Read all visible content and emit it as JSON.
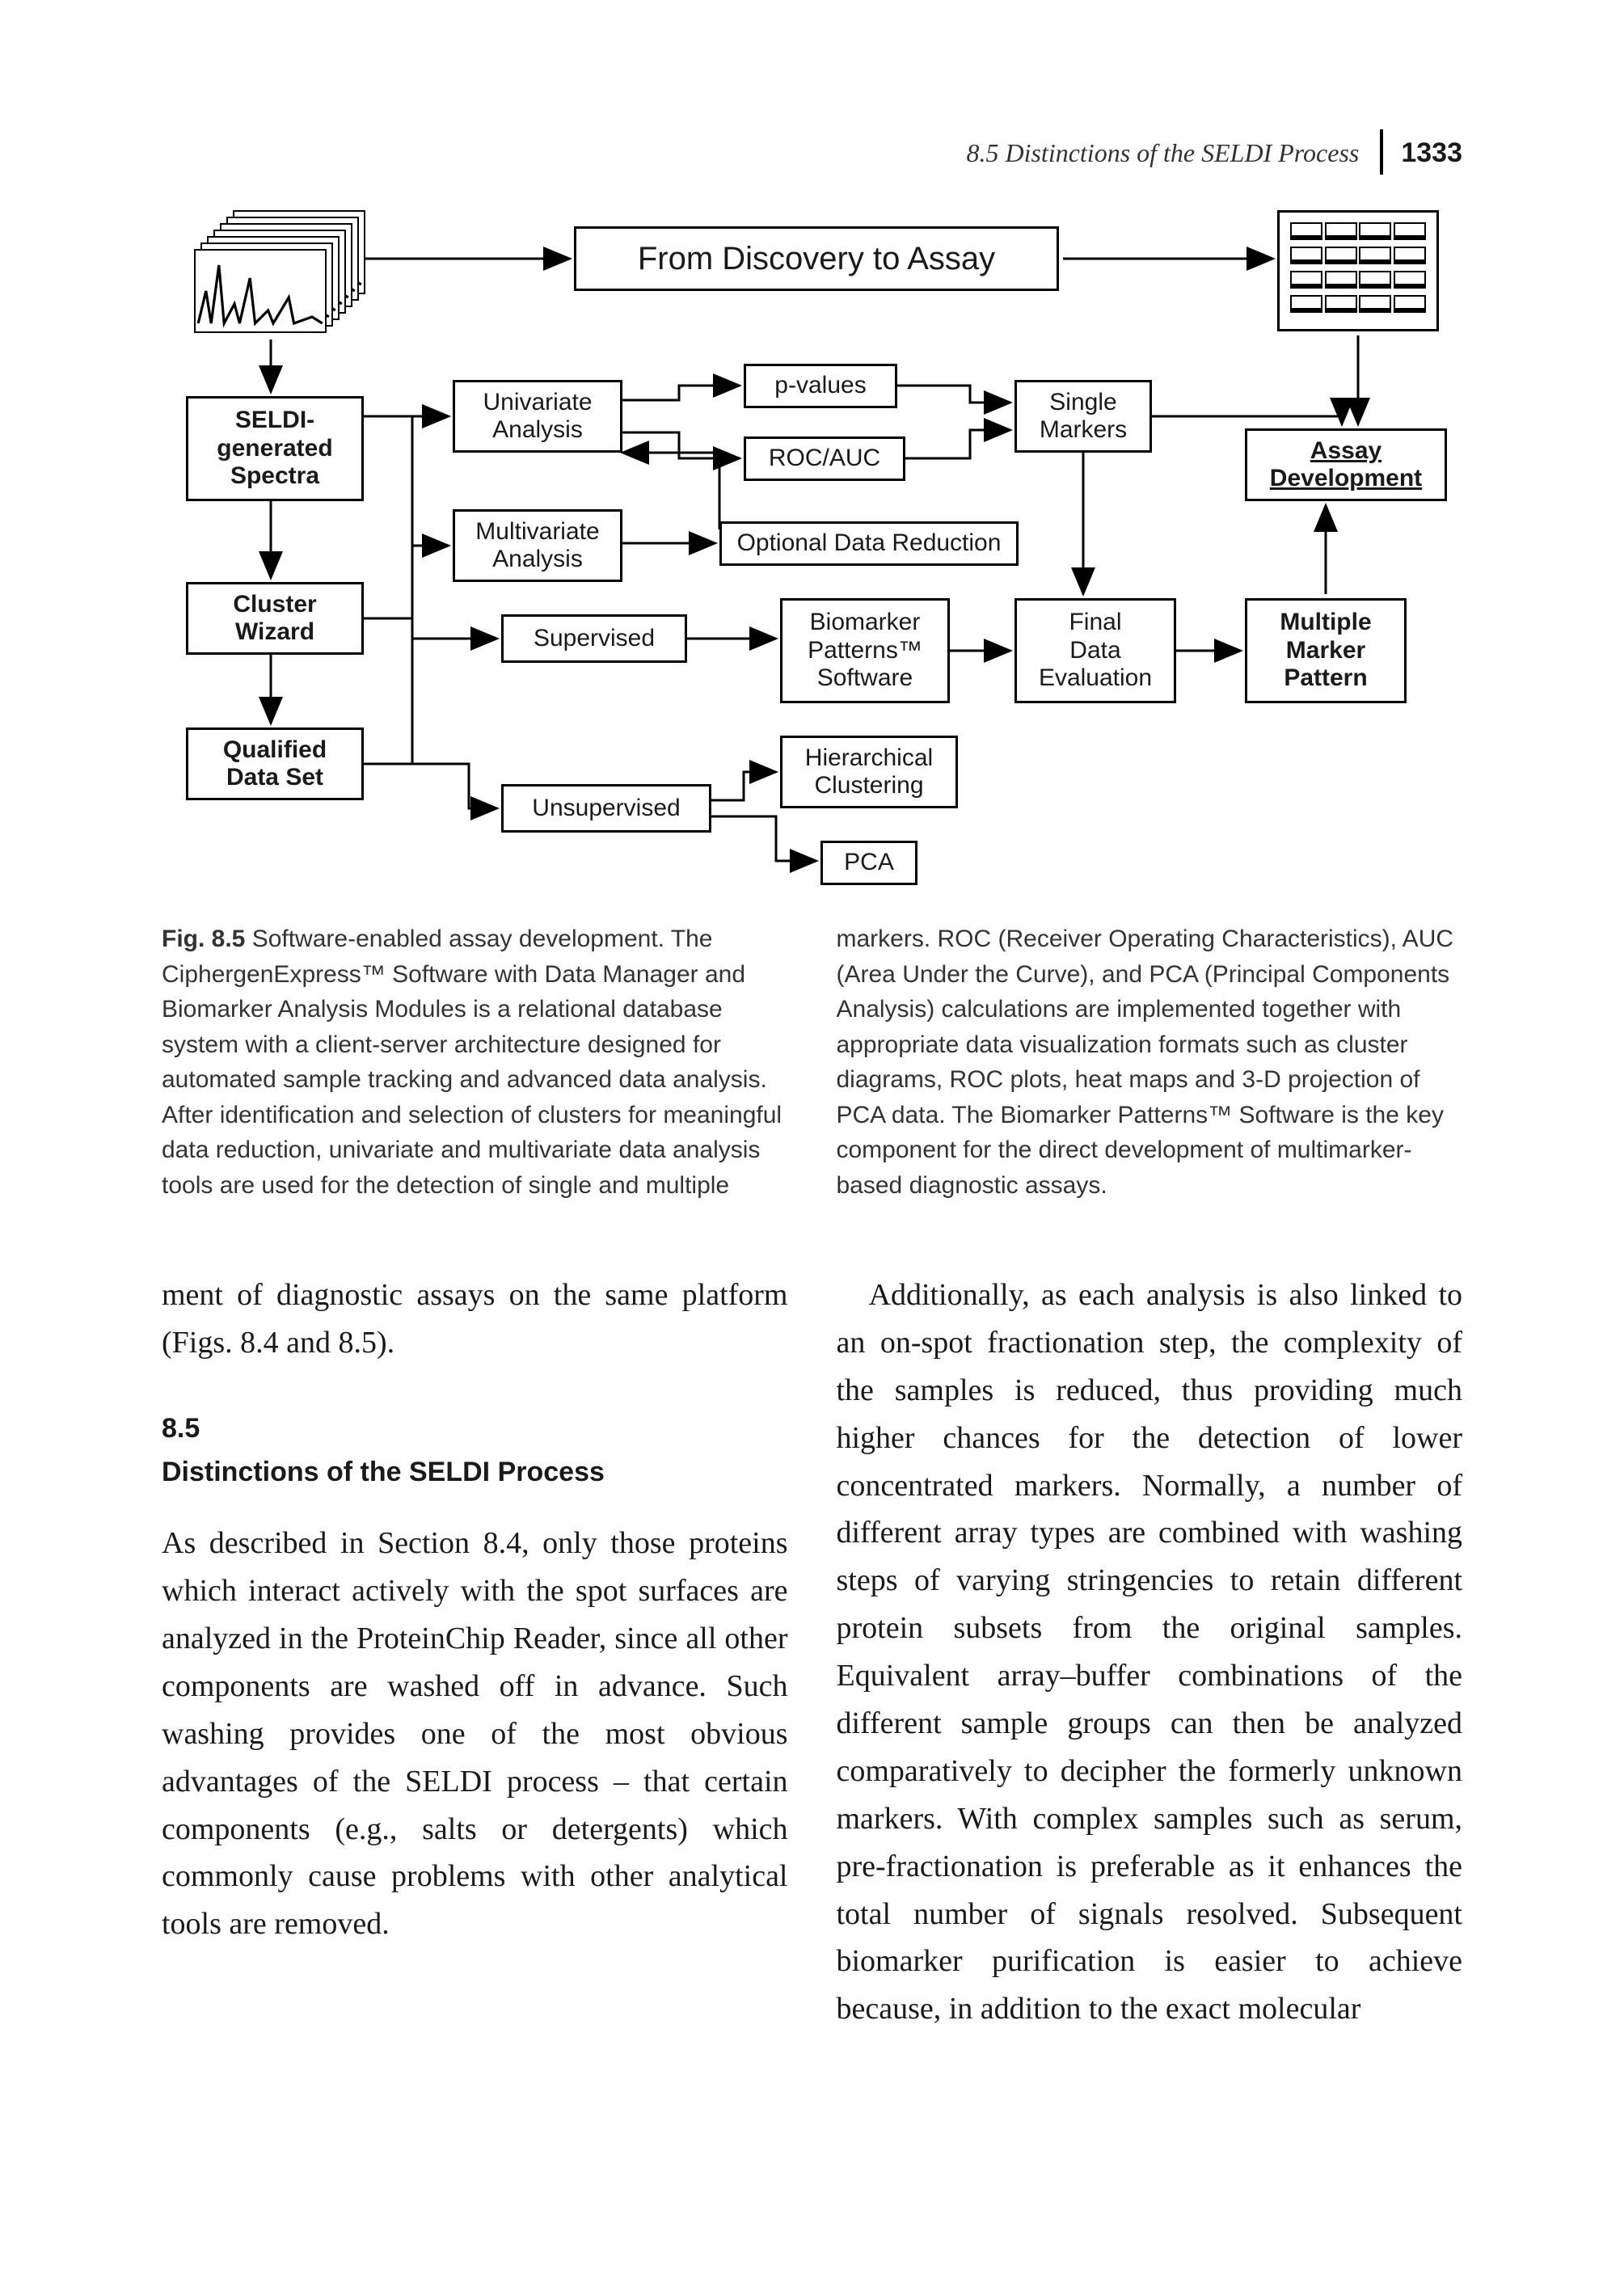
{
  "header": {
    "running_title": "8.5  Distinctions of the SELDI Process",
    "page_number": "1333"
  },
  "figure": {
    "banner": "From Discovery to Assay",
    "nodes": {
      "seldi_spectra": "SELDI-\ngenerated\nSpectra",
      "cluster_wizard": "Cluster\nWizard",
      "qualified_dataset": "Qualified\nData Set",
      "univariate": "Univariate\nAnalysis",
      "multivariate": "Multivariate\nAnalysis",
      "supervised": "Supervised",
      "unsupervised": "Unsupervised",
      "pvalues": "p-values",
      "roc_auc": "ROC/AUC",
      "odr": "Optional Data Reduction",
      "bmp": "Biomarker\nPatterns™\nSoftware",
      "hcl": "Hierarchical\nClustering",
      "pca": "PCA",
      "single_markers": "Single\nMarkers",
      "final_eval": "Final\nData\nEvaluation",
      "assay_dev": "Assay\nDevelopment",
      "multi_pattern": "Multiple\nMarker\nPattern"
    }
  },
  "chart_data": {
    "type": "flow-diagram",
    "title": "From Discovery to Assay",
    "nodes": [
      {
        "id": "discovery_banner",
        "label": "From Discovery to Assay",
        "kind": "banner"
      },
      {
        "id": "seldi_spectra",
        "label": "SELDI-generated Spectra"
      },
      {
        "id": "cluster_wizard",
        "label": "Cluster Wizard"
      },
      {
        "id": "qualified_dataset",
        "label": "Qualified Data Set"
      },
      {
        "id": "univariate",
        "label": "Univariate Analysis"
      },
      {
        "id": "multivariate",
        "label": "Multivariate Analysis"
      },
      {
        "id": "supervised",
        "label": "Supervised"
      },
      {
        "id": "unsupervised",
        "label": "Unsupervised"
      },
      {
        "id": "pvalues",
        "label": "p-values"
      },
      {
        "id": "roc_auc",
        "label": "ROC/AUC"
      },
      {
        "id": "odr",
        "label": "Optional Data Reduction"
      },
      {
        "id": "bmp",
        "label": "Biomarker Patterns™ Software"
      },
      {
        "id": "hcl",
        "label": "Hierarchical Clustering"
      },
      {
        "id": "pca",
        "label": "PCA"
      },
      {
        "id": "single_markers",
        "label": "Single Markers"
      },
      {
        "id": "final_eval",
        "label": "Final Data Evaluation"
      },
      {
        "id": "multi_pattern",
        "label": "Multiple Marker Pattern"
      },
      {
        "id": "assay_dev",
        "label": "Assay Development"
      }
    ],
    "edges": [
      {
        "from": "seldi_spectra",
        "to": "cluster_wizard"
      },
      {
        "from": "cluster_wizard",
        "to": "qualified_dataset"
      },
      {
        "from": "qualified_dataset",
        "to": "univariate"
      },
      {
        "from": "qualified_dataset",
        "to": "multivariate"
      },
      {
        "from": "qualified_dataset",
        "to": "supervised"
      },
      {
        "from": "qualified_dataset",
        "to": "unsupervised"
      },
      {
        "from": "univariate",
        "to": "pvalues"
      },
      {
        "from": "univariate",
        "to": "roc_auc"
      },
      {
        "from": "multivariate",
        "to": "odr"
      },
      {
        "from": "odr",
        "to": "univariate"
      },
      {
        "from": "supervised",
        "to": "bmp"
      },
      {
        "from": "unsupervised",
        "to": "hcl"
      },
      {
        "from": "unsupervised",
        "to": "pca"
      },
      {
        "from": "pvalues",
        "to": "single_markers"
      },
      {
        "from": "roc_auc",
        "to": "single_markers"
      },
      {
        "from": "bmp",
        "to": "final_eval"
      },
      {
        "from": "single_markers",
        "to": "final_eval"
      },
      {
        "from": "single_markers",
        "to": "assay_dev"
      },
      {
        "from": "final_eval",
        "to": "multi_pattern"
      },
      {
        "from": "multi_pattern",
        "to": "assay_dev"
      }
    ]
  },
  "caption": {
    "lead": "Fig. 8.5",
    "left": " Software-enabled assay development. The CiphergenExpress™ Software with Data Manager and Biomarker Analysis Modules is a relational database system with a client-server architecture designed for automated sample tracking and advanced data analysis. After identification and selection of clusters for meaningful data reduction, univariate and multivariate data analysis tools are used for the detection of single and multiple",
    "right": "markers. ROC (Receiver Operating Characteristics), AUC (Area Under the Curve), and PCA (Principal Components Analysis) calculations are implemented together with appropriate data visualization formats such as cluster diagrams, ROC plots, heat maps and 3-D projection of PCA data. The Biomarker Patterns™ Software is the key component for the direct development of multimarker-based diagnostic assays."
  },
  "body": {
    "left_intro": "ment of diagnostic assays on the same platform (Figs. 8.4 and 8.5).",
    "section_number": "8.5",
    "section_title": "Distinctions of the SELDI Process",
    "left_para": "As described in Section 8.4, only those proteins which interact actively with the spot surfaces are analyzed in the ProteinChip Reader, since all other components are washed off in advance. Such washing provides one of the most obvious advantages of the SELDI process – that certain components (e.g., salts or detergents) which commonly cause problems with other analytical tools are removed.",
    "right_para": "Additionally, as each analysis is also linked to an on-spot fractionation step, the complexity of the samples is reduced, thus providing much higher chances for the detection of lower concentrated markers. Normally, a number of different array types are combined with washing steps of varying stringencies to retain different protein subsets from the original samples. Equivalent array–buffer combinations of the different sample groups can then be analyzed comparatively to decipher the formerly unknown markers. With complex samples such as serum, pre-fractionation is preferable as it enhances the total number of signals resolved. Subsequent biomarker purification is easier to achieve because, in addition to the exact molecular"
  }
}
